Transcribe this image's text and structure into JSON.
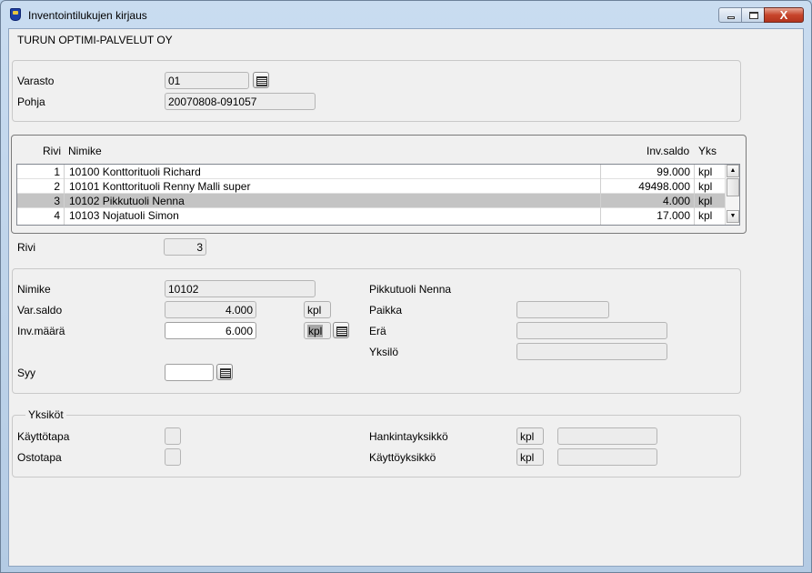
{
  "window": {
    "title": "Inventointilukujen kirjaus",
    "close_label": "X"
  },
  "company": "TURUN OPTIMI-PALVELUT OY",
  "header": {
    "varasto_label": "Varasto",
    "varasto_value": "01",
    "pohja_label": "Pohja",
    "pohja_value": "20070808-091057"
  },
  "grid": {
    "columns": {
      "rivi": "Rivi",
      "nimike": "Nimike",
      "inv_saldo": "Inv.saldo",
      "yks": "Yks"
    },
    "rows": [
      {
        "rivi": "1",
        "nimike": "10100 Konttorituoli Richard",
        "inv_saldo": "99.000",
        "yks": "kpl"
      },
      {
        "rivi": "2",
        "nimike": "10101 Konttorituoli Renny Malli super",
        "inv_saldo": "49498.000",
        "yks": "kpl"
      },
      {
        "rivi": "3",
        "nimike": "10102 Pikkutuoli Nenna",
        "inv_saldo": "4.000",
        "yks": "kpl"
      },
      {
        "rivi": "4",
        "nimike": "10103 Nojatuoli Simon",
        "inv_saldo": "17.000",
        "yks": "kpl"
      }
    ],
    "selected_row": 3
  },
  "row_field": {
    "label": "Rivi",
    "value": "3"
  },
  "detail": {
    "nimike_label": "Nimike",
    "nimike_value": "10102",
    "nimike_name": "Pikkutuoli Nenna",
    "var_saldo_label": "Var.saldo",
    "var_saldo_value": "4.000",
    "var_saldo_unit": "kpl",
    "inv_maara_label": "Inv.määrä",
    "inv_maara_value": "6.000",
    "inv_maara_unit": "kpl",
    "syy_label": "Syy",
    "syy_value": "",
    "paikka_label": "Paikka",
    "paikka_value": "",
    "era_label": "Erä",
    "era_value": "",
    "yksilo_label": "Yksilö",
    "yksilo_value": ""
  },
  "units": {
    "legend": "Yksiköt",
    "kayttotapa_label": "Käyttötapa",
    "ostotapa_label": "Ostotapa",
    "hankintayksikko_label": "Hankintayksikkö",
    "hankintayksikko_value": "kpl",
    "hankintayksikko_extra": "",
    "kayttoyksikko_label": "Käyttöyksikkö",
    "kayttoyksikko_value": "kpl",
    "kayttoyksikko_extra": ""
  }
}
